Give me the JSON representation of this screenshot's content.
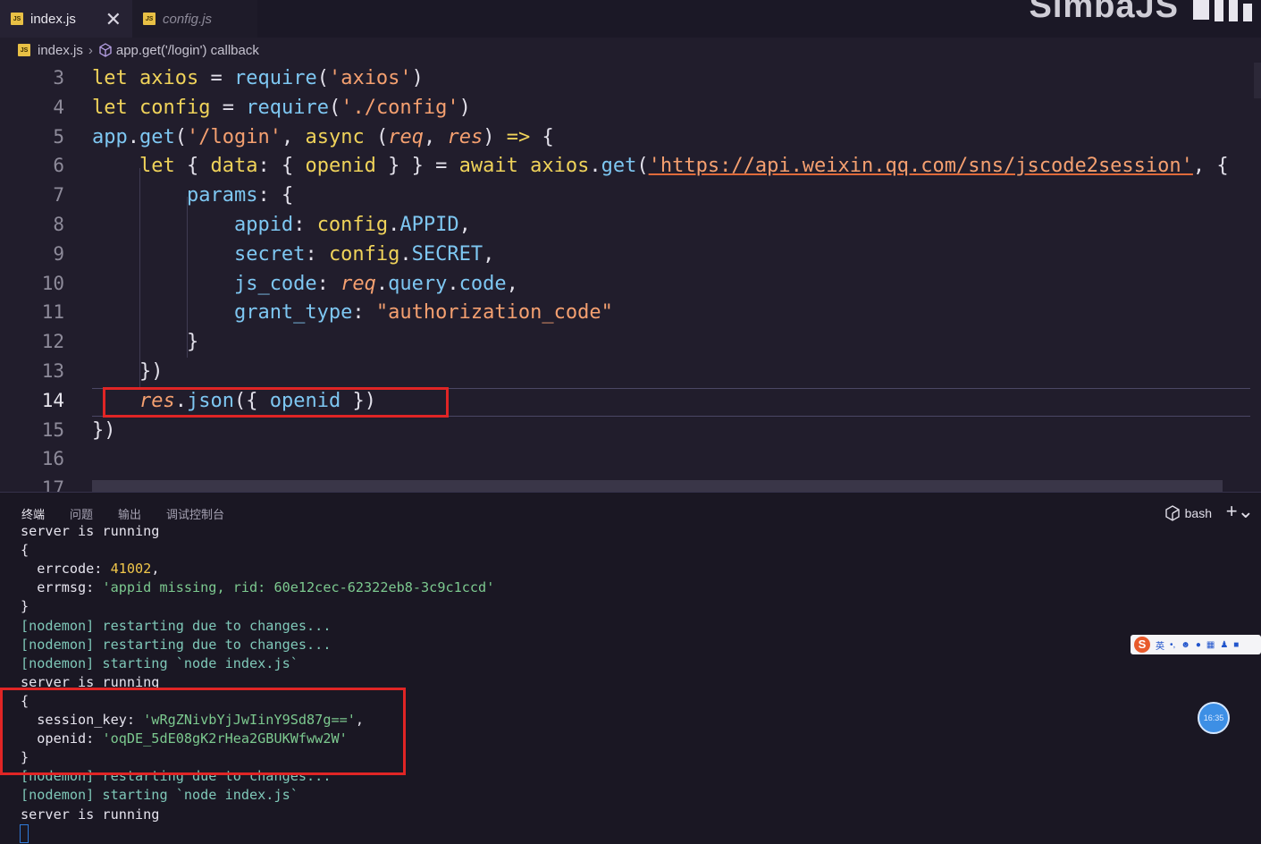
{
  "tabs": [
    {
      "label": "index.js",
      "active": true
    },
    {
      "label": "config.js",
      "active": false
    }
  ],
  "brand": "SimbaJS",
  "breadcrumb": {
    "file": "index.js",
    "symbol": "app.get('/login') callback"
  },
  "editor": {
    "line_numbers": [
      "3",
      "4",
      "5",
      "6",
      "7",
      "8",
      "9",
      "10",
      "11",
      "12",
      "13",
      "14",
      "15",
      "16",
      "17"
    ],
    "current_line": "14",
    "lines": [
      [
        {
          "t": "let",
          "c": "kw"
        },
        {
          "t": " "
        },
        {
          "t": "axios",
          "c": "var"
        },
        {
          "t": " = "
        },
        {
          "t": "require",
          "c": "fn"
        },
        {
          "t": "("
        },
        {
          "t": "'axios'",
          "c": "str"
        },
        {
          "t": ")"
        }
      ],
      [
        {
          "t": "let",
          "c": "kw"
        },
        {
          "t": " "
        },
        {
          "t": "config",
          "c": "var"
        },
        {
          "t": " = "
        },
        {
          "t": "require",
          "c": "fn"
        },
        {
          "t": "("
        },
        {
          "t": "'./config'",
          "c": "str"
        },
        {
          "t": ")"
        }
      ],
      [
        {
          "t": "app",
          "c": "prop"
        },
        {
          "t": "."
        },
        {
          "t": "get",
          "c": "fn"
        },
        {
          "t": "("
        },
        {
          "t": "'/login'",
          "c": "str"
        },
        {
          "t": ", "
        },
        {
          "t": "async",
          "c": "kw"
        },
        {
          "t": " ("
        },
        {
          "t": "req",
          "c": "prm"
        },
        {
          "t": ", "
        },
        {
          "t": "res",
          "c": "prm"
        },
        {
          "t": ") "
        },
        {
          "t": "=>",
          "c": "kw"
        },
        {
          "t": " {"
        }
      ],
      [
        {
          "t": "    "
        },
        {
          "t": "let",
          "c": "kw"
        },
        {
          "t": " { "
        },
        {
          "t": "data",
          "c": "var"
        },
        {
          "t": ": { "
        },
        {
          "t": "openid",
          "c": "var"
        },
        {
          "t": " } } = "
        },
        {
          "t": "await",
          "c": "kw"
        },
        {
          "t": " "
        },
        {
          "t": "axios",
          "c": "var"
        },
        {
          "t": "."
        },
        {
          "t": "get",
          "c": "fn"
        },
        {
          "t": "("
        },
        {
          "t": "'https://api.weixin.qq.com/sns/jscode2session'",
          "c": "url"
        },
        {
          "t": ", {"
        }
      ],
      [
        {
          "t": "        "
        },
        {
          "t": "params",
          "c": "prop"
        },
        {
          "t": ": {"
        }
      ],
      [
        {
          "t": "            "
        },
        {
          "t": "appid",
          "c": "prop"
        },
        {
          "t": ": "
        },
        {
          "t": "config",
          "c": "var"
        },
        {
          "t": "."
        },
        {
          "t": "APPID",
          "c": "prop"
        },
        {
          "t": ","
        }
      ],
      [
        {
          "t": "            "
        },
        {
          "t": "secret",
          "c": "prop"
        },
        {
          "t": ": "
        },
        {
          "t": "config",
          "c": "var"
        },
        {
          "t": "."
        },
        {
          "t": "SECRET",
          "c": "prop"
        },
        {
          "t": ","
        }
      ],
      [
        {
          "t": "            "
        },
        {
          "t": "js_code",
          "c": "prop"
        },
        {
          "t": ": "
        },
        {
          "t": "req",
          "c": "prm"
        },
        {
          "t": "."
        },
        {
          "t": "query",
          "c": "prop"
        },
        {
          "t": "."
        },
        {
          "t": "code",
          "c": "prop"
        },
        {
          "t": ","
        }
      ],
      [
        {
          "t": "            "
        },
        {
          "t": "grant_type",
          "c": "prop"
        },
        {
          "t": ": "
        },
        {
          "t": "\"authorization_code\"",
          "c": "str"
        }
      ],
      [
        {
          "t": "        }"
        }
      ],
      [
        {
          "t": "    })"
        }
      ],
      [
        {
          "t": "    "
        },
        {
          "t": "res",
          "c": "prm"
        },
        {
          "t": "."
        },
        {
          "t": "json",
          "c": "fn"
        },
        {
          "t": "({ "
        },
        {
          "t": "openid",
          "c": "prop"
        },
        {
          "t": " })"
        }
      ],
      [
        {
          "t": "})"
        }
      ],
      [],
      []
    ]
  },
  "panel": {
    "tabs": [
      "终端",
      "问题",
      "输出",
      "调试控制台"
    ],
    "active_tab": "终端",
    "shell": "bash",
    "lines": [
      [
        {
          "t": "server is running"
        }
      ],
      [
        {
          "t": "{"
        }
      ],
      [
        {
          "t": "  errcode: "
        },
        {
          "t": "41002",
          "c": "t-num"
        },
        {
          "t": ","
        }
      ],
      [
        {
          "t": "  errmsg: "
        },
        {
          "t": "'appid missing, rid: 60e12cec-62322eb8-3c9c1ccd'",
          "c": "t-str"
        }
      ],
      [
        {
          "t": "}"
        }
      ],
      [
        {
          "t": "[nodemon] restarting due to changes...",
          "c": "t-dim"
        }
      ],
      [
        {
          "t": "[nodemon] restarting due to changes...",
          "c": "t-dim"
        }
      ],
      [
        {
          "t": "[nodemon] starting `node index.js`",
          "c": "t-dim"
        }
      ],
      [
        {
          "t": "server is running"
        }
      ],
      [
        {
          "t": "{"
        }
      ],
      [
        {
          "t": "  session_key: "
        },
        {
          "t": "'wRgZNivbYjJwIinY9Sd87g=='",
          "c": "t-str"
        },
        {
          "t": ","
        }
      ],
      [
        {
          "t": "  openid: "
        },
        {
          "t": "'oqDE_5dE08gK2rHea2GBUKWfww2W'",
          "c": "t-str"
        }
      ],
      [
        {
          "t": "}"
        }
      ],
      [
        {
          "t": "[nodemon] restarting due to changes...",
          "c": "t-dim"
        }
      ],
      [
        {
          "t": "[nodemon] starting `node index.js`",
          "c": "t-dim"
        }
      ],
      [
        {
          "t": "server is running"
        }
      ]
    ]
  },
  "ime": {
    "logo": "S",
    "lang": "英"
  },
  "clock": "16:35"
}
